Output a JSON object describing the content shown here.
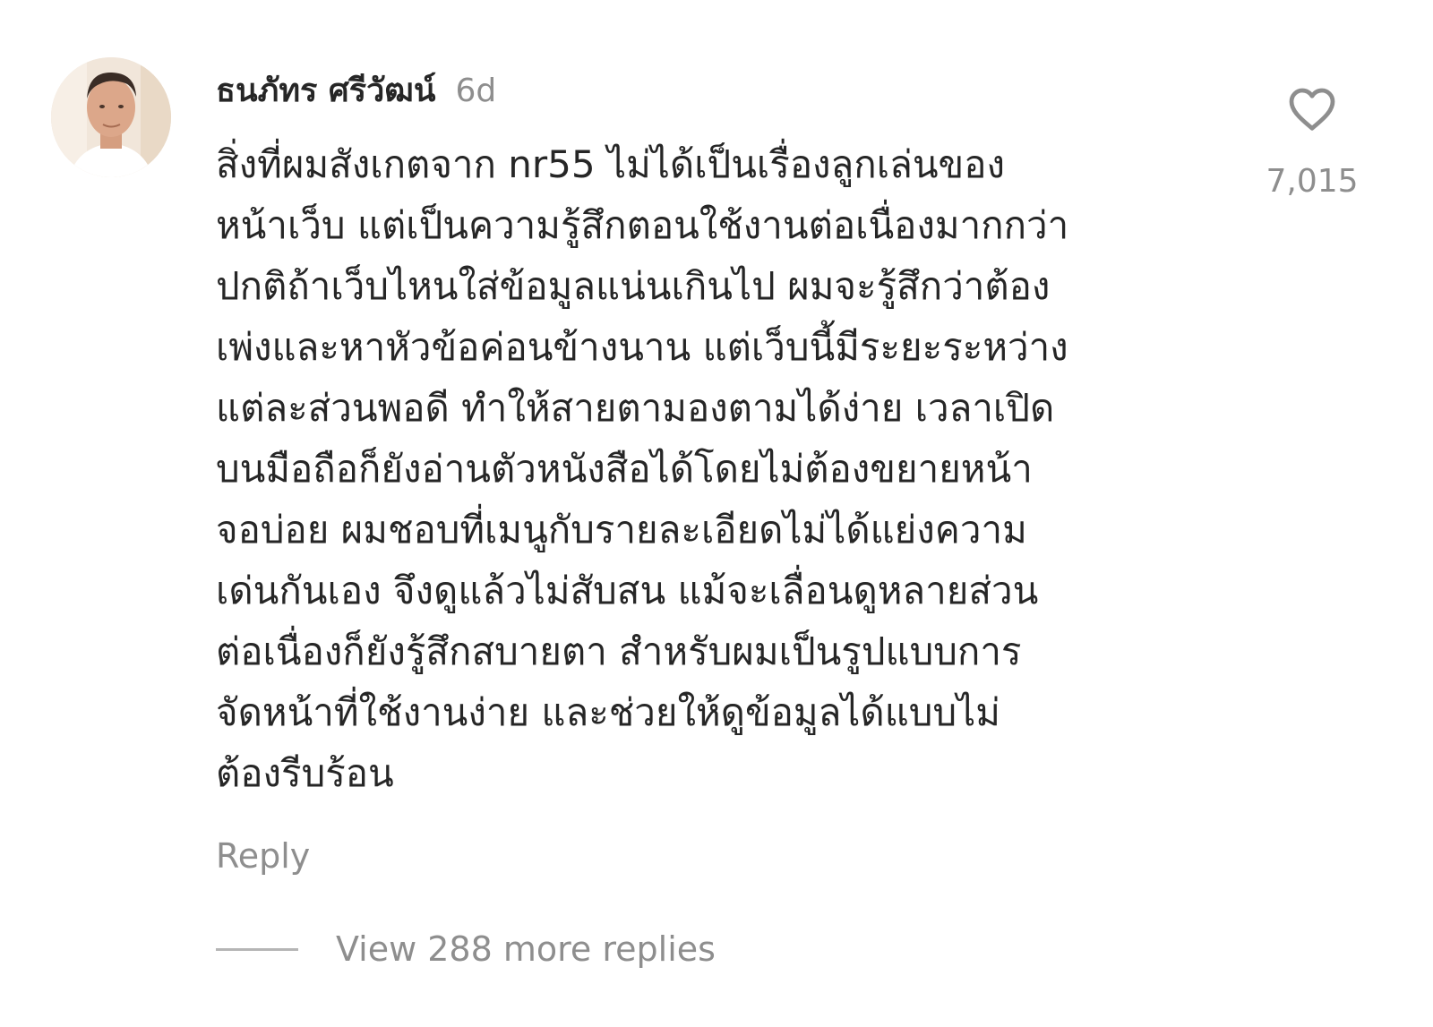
{
  "comment": {
    "avatar_icon": "user-avatar-photo",
    "username": "ธนภัทร ศรีวัฒน์",
    "time": "6d",
    "body_lines": [
      "สิ่งที่ผมสังเกตจาก nr55 ไม่ได้เป็นเรื่องลูกเล่นของ",
      "หน้าเว็บ แต่เป็นความรู้สึกตอนใช้งานต่อเนื่องมากกว่า",
      "ปกติถ้าเว็บไหนใส่ข้อมูลแน่นเกินไป ผมจะรู้สึกว่าต้อง",
      "เพ่งและหาหัวข้อค่อนข้างนาน แต่เว็บนี้มีระยะระหว่าง",
      "แต่ละส่วนพอดี ทำให้สายตามองตามได้ง่าย เวลาเปิด",
      "บนมือถือก็ยังอ่านตัวหนังสือได้โดยไม่ต้องขยายหน้า",
      "จอบ่อย ผมชอบที่เมนูกับรายละเอียดไม่ได้แย่งความ",
      "เด่นกันเอง จึงดูแล้วไม่สับสน แม้จะเลื่อนดูหลายส่วน",
      "ต่อเนื่องก็ยังรู้สึกสบายตา สำหรับผมเป็นรูปแบบการ",
      "จัดหน้าที่ใช้งานง่าย และช่วยให้ดูข้อมูลได้แบบไม่",
      "ต้องรีบร้อน"
    ],
    "like_icon": "heart-outline-icon",
    "like_count": "7,015",
    "reply_label": "Reply",
    "more_replies_label": "View 288 more replies"
  },
  "colors": {
    "text": "#262626",
    "muted": "#8e8e8e",
    "background": "#ffffff"
  }
}
